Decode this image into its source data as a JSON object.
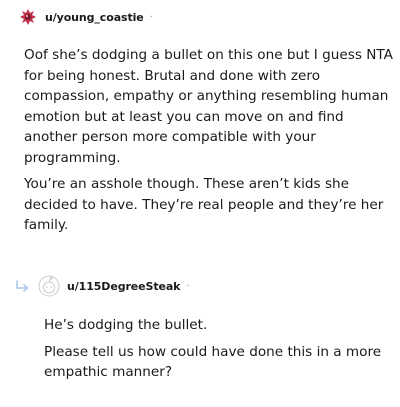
{
  "comment": {
    "username": "u/young_coastie",
    "dot": "·",
    "paragraphs": [
      "Oof she’s dodging a bullet on this one but I guess NTA for being honest. Brutal and done with zero compassion, empathy or anything resembling human emotion but at least you can move on and find another person more compatible with your programming.",
      "You’re an asshole though. These aren’t kids she decided to have. They’re real people and they’re her family."
    ]
  },
  "reply": {
    "username": "u/115DegreeSteak",
    "dot": "·",
    "paragraphs": [
      "He’s dodging the bullet.",
      "Please tell us how could have done this in a more empathic manner?"
    ]
  },
  "icons": {
    "avatar_1": "snoo-avatar-icon",
    "avatar_2": "default-avatar-icon",
    "reply_arrow": "reply-arrow-icon"
  },
  "colors": {
    "text": "#1a1a1b",
    "muted": "#878a8c",
    "avatar_accent": "#c0304a"
  }
}
